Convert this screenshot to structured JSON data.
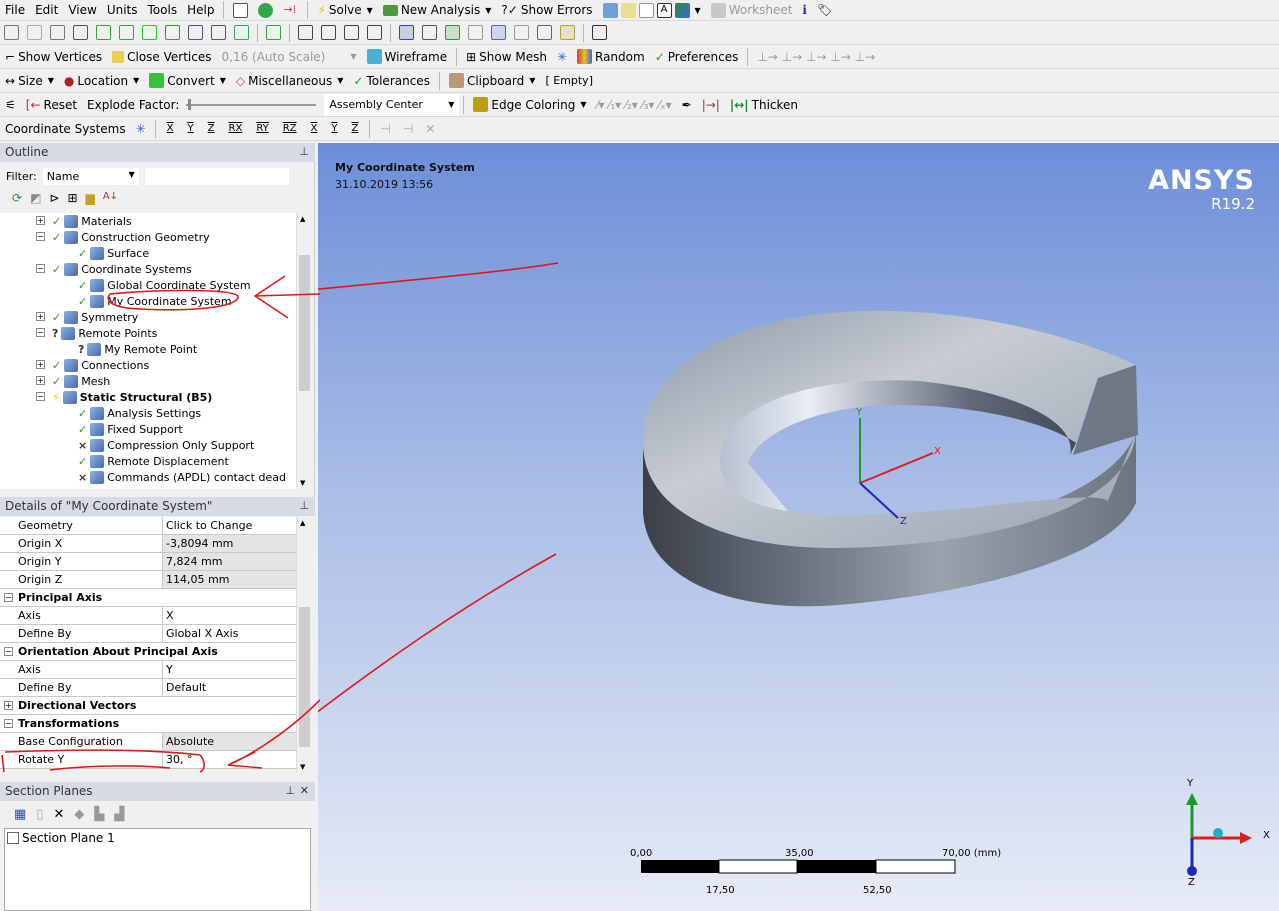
{
  "menu": [
    "File",
    "Edit",
    "View",
    "Units",
    "Tools",
    "Help"
  ],
  "toolbar1": {
    "solve": "Solve",
    "new_analysis": "New Analysis",
    "show_errors": "Show Errors",
    "worksheet": "Worksheet"
  },
  "toolbar3": {
    "show_vertices": "Show Vertices",
    "close_vertices": "Close Vertices",
    "scale": "0,16 (Auto Scale)",
    "wireframe": "Wireframe",
    "show_mesh": "Show Mesh",
    "random": "Random",
    "preferences": "Preferences"
  },
  "toolbar4": {
    "size": "Size",
    "location": "Location",
    "convert": "Convert",
    "miscellaneous": "Miscellaneous",
    "tolerances": "Tolerances",
    "clipboard": "Clipboard",
    "clipboard_state": "[ Empty]"
  },
  "toolbar5": {
    "reset": "Reset",
    "explode_factor": "Explode Factor:",
    "assembly_center": "Assembly Center",
    "edge_coloring": "Edge Coloring",
    "thicken": "Thicken",
    "explode_value": 0
  },
  "toolbar6": {
    "label": "Coordinate Systems",
    "buttons": [
      "X",
      "Y",
      "Z",
      "RX",
      "RY",
      "RZ",
      "X",
      "Y",
      "Z"
    ]
  },
  "outline": {
    "title": "Outline",
    "filter_label": "Filter:",
    "filter_value": "Name",
    "filter_text": "",
    "tree": [
      {
        "label": "Materials",
        "level": 1,
        "status": "ok",
        "exp": "+",
        "icon": "materials-icon"
      },
      {
        "label": "Construction Geometry",
        "level": 1,
        "status": "ok",
        "exp": "-",
        "icon": "construction-geometry-icon"
      },
      {
        "label": "Surface",
        "level": 2,
        "status": "ok",
        "icon": "surface-icon"
      },
      {
        "label": "Coordinate Systems",
        "level": 1,
        "status": "ok",
        "exp": "-",
        "icon": "coordinate-systems-icon"
      },
      {
        "label": "Global Coordinate System",
        "level": 2,
        "status": "ok",
        "icon": "coordinate-system-icon"
      },
      {
        "label": "My Coordinate System",
        "level": 2,
        "status": "ok",
        "icon": "coordinate-system-icon",
        "selected": true
      },
      {
        "label": "Symmetry",
        "level": 1,
        "status": "ok",
        "exp": "+",
        "icon": "symmetry-icon"
      },
      {
        "label": "Remote Points",
        "level": 1,
        "status": "?",
        "exp": "-",
        "icon": "remote-points-icon"
      },
      {
        "label": "My Remote Point",
        "level": 2,
        "status": "?",
        "icon": "remote-point-icon"
      },
      {
        "label": "Connections",
        "level": 1,
        "status": "ok",
        "exp": "+",
        "icon": "connections-icon"
      },
      {
        "label": "Mesh",
        "level": 1,
        "status": "ok",
        "exp": "+",
        "icon": "mesh-icon"
      },
      {
        "label": "Static Structural (B5)",
        "level": 1,
        "status": "bolt",
        "exp": "-",
        "icon": "static-structural-icon",
        "bold": true
      },
      {
        "label": "Analysis Settings",
        "level": 2,
        "status": "ok",
        "icon": "analysis-settings-icon"
      },
      {
        "label": "Fixed Support",
        "level": 2,
        "status": "ok",
        "icon": "fixed-support-icon"
      },
      {
        "label": "Compression Only Support",
        "level": 2,
        "status": "x",
        "icon": "compression-support-icon"
      },
      {
        "label": "Remote Displacement",
        "level": 2,
        "status": "ok",
        "icon": "remote-displacement-icon"
      },
      {
        "label": "Commands (APDL) contact dead",
        "level": 2,
        "status": "x",
        "icon": "commands-icon"
      }
    ]
  },
  "details": {
    "title": "Details of \"My Coordinate System\"",
    "rows": [
      {
        "k": "Geometry",
        "v": "Click to Change"
      },
      {
        "k": "Origin X",
        "v": "-3,8094 mm",
        "gray": true
      },
      {
        "k": "Origin Y",
        "v": "7,824 mm",
        "gray": true
      },
      {
        "k": "Origin Z",
        "v": "114,05 mm",
        "gray": true
      },
      {
        "k": "Principal Axis",
        "group": "-"
      },
      {
        "k": "Axis",
        "v": "X"
      },
      {
        "k": "Define By",
        "v": "Global X Axis"
      },
      {
        "k": "Orientation About Principal Axis",
        "group": "-"
      },
      {
        "k": "Axis",
        "v": "Y"
      },
      {
        "k": "Define By",
        "v": "Default"
      },
      {
        "k": "Directional Vectors",
        "group": "+"
      },
      {
        "k": "Transformations",
        "group": "-"
      },
      {
        "k": "Base Configuration",
        "v": "Absolute",
        "gray": true
      },
      {
        "k": "Rotate Y",
        "v": "30, °"
      }
    ]
  },
  "section_planes": {
    "title": "Section Planes",
    "items": [
      "Section Plane 1"
    ]
  },
  "viewport": {
    "title": "My Coordinate System",
    "date": "31.10.2019 13:56",
    "brand": "ANSYS",
    "version": "R19.2",
    "scale": {
      "top": [
        "0,00",
        "35,00",
        "70,00 (mm)"
      ],
      "bottom": [
        "17,50",
        "52,50"
      ]
    },
    "axes": {
      "x": "X",
      "y": "Y",
      "z": "Z"
    }
  },
  "colors": {
    "viewport_top": "#6d8ed8",
    "viewport_bottom": "#e6ebf6",
    "annotation": "#e01818",
    "panel_header": "#d6dbe6"
  }
}
